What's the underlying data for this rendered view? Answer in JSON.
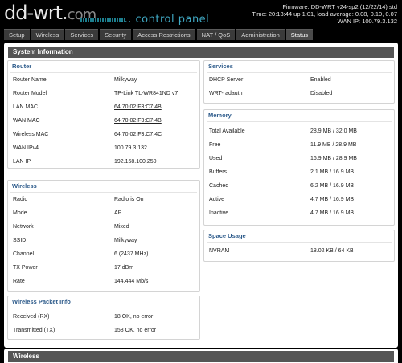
{
  "header": {
    "logo_main": "dd-wrt",
    "logo_dot": ".",
    "logo_com": "com",
    "subtitle": "... control panel",
    "firmware": "Firmware: DD-WRT v24-sp2 (12/22/14) std",
    "time": "Time: 20:13:44 up 1:01, load average: 0.08, 0.10, 0.07",
    "wan_ip": "WAN IP: 100.79.3.132"
  },
  "tabs": [
    {
      "label": "Setup"
    },
    {
      "label": "Wireless"
    },
    {
      "label": "Services"
    },
    {
      "label": "Security"
    },
    {
      "label": "Access Restrictions"
    },
    {
      "label": "NAT / QoS"
    },
    {
      "label": "Administration"
    },
    {
      "label": "Status"
    }
  ],
  "main_title": "System Information",
  "router": {
    "title": "Router",
    "rows": [
      {
        "k": "Router Name",
        "v": "Milkyway"
      },
      {
        "k": "Router Model",
        "v": "TP-Link TL-WR841ND v7"
      },
      {
        "k": "LAN MAC",
        "v": "64:70:02:F3:C7:4B"
      },
      {
        "k": "WAN MAC",
        "v": "64:70:02:F3:C7:4B"
      },
      {
        "k": "Wireless MAC",
        "v": "64:70:02:F3:C7:4C"
      },
      {
        "k": "WAN IPv4",
        "v": "100.79.3.132"
      },
      {
        "k": "LAN IP",
        "v": "192.168.100.250"
      }
    ]
  },
  "wireless": {
    "title": "Wireless",
    "rows": [
      {
        "k": "Radio",
        "v": "Radio is On"
      },
      {
        "k": "Mode",
        "v": "AP"
      },
      {
        "k": "Network",
        "v": "Mixed"
      },
      {
        "k": "SSID",
        "v": "Milkyway"
      },
      {
        "k": "Channel",
        "v": "6 (2437 MHz)"
      },
      {
        "k": "TX Power",
        "v": "17 dBm"
      },
      {
        "k": "Rate",
        "v": "144.444 Mb/s"
      }
    ]
  },
  "packet_info": {
    "title": "Wireless Packet Info",
    "rows": [
      {
        "k": "Received (RX)",
        "v": "18 OK, no error"
      },
      {
        "k": "Transmitted (TX)",
        "v": "158 OK, no error"
      }
    ]
  },
  "services": {
    "title": "Services",
    "rows": [
      {
        "k": "DHCP Server",
        "v": "Enabled"
      },
      {
        "k": "WRT-radauth",
        "v": "Disabled"
      }
    ]
  },
  "memory": {
    "title": "Memory",
    "rows": [
      {
        "k": "Total Available",
        "v": "28.9 MB / 32.0 MB"
      },
      {
        "k": "Free",
        "v": "11.9 MB / 28.9 MB"
      },
      {
        "k": "Used",
        "v": "16.9 MB / 28.9 MB"
      },
      {
        "k": "Buffers",
        "v": "2.1 MB / 16.9 MB"
      },
      {
        "k": "Cached",
        "v": "6.2 MB / 16.9 MB"
      },
      {
        "k": "Active",
        "v": "4.7 MB / 16.9 MB"
      },
      {
        "k": "Inactive",
        "v": "4.7 MB / 16.9 MB"
      }
    ]
  },
  "space": {
    "title": "Space Usage",
    "rows": [
      {
        "k": "NVRAM",
        "v": "18.02 KB / 64 KB"
      }
    ]
  },
  "bottom_title": "Wireless",
  "colors": {
    "accent_blue": "#2c5a8a",
    "panel_header": "#555555",
    "tab_bg": "#3a3a3a",
    "logo_accent": "#3fa7c2"
  }
}
